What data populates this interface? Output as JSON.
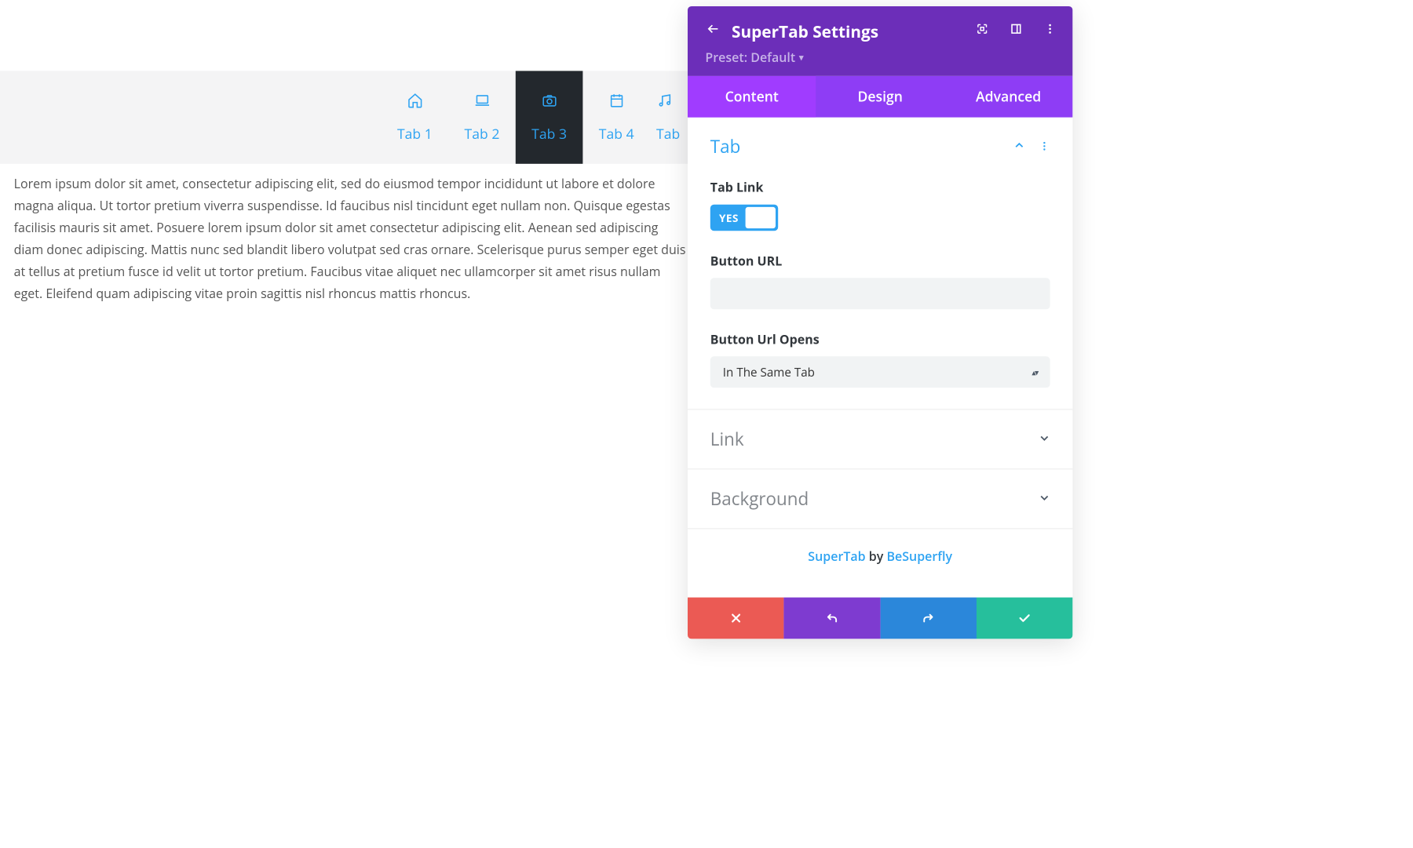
{
  "tabs": [
    {
      "label": "Tab 1",
      "icon": "home"
    },
    {
      "label": "Tab 2",
      "icon": "laptop"
    },
    {
      "label": "Tab 3",
      "icon": "camera",
      "active": true
    },
    {
      "label": "Tab 4",
      "icon": "calendar"
    },
    {
      "label": "Tab",
      "icon": "music"
    }
  ],
  "content_text": "Lorem ipsum dolor sit amet, consectetur adipiscing elit, sed do eiusmod tempor incididunt ut labore et dolore magna aliqua. Ut tortor pretium viverra suspendisse. Id faucibus nisl tincidunt eget nullam non. Quisque egestas facilisis mauris sit amet. Posuere lorem ipsum dolor sit amet consectetur adipiscing elit. Aenean sed adipiscing diam donec adipiscing. Mattis nunc sed blandit libero volutpat sed cras ornare. Scelerisque purus semper eget duis at tellus at pretium fusce id velit ut tortor pretium. Faucibus vitae aliquet nec ullamcorper sit amet risus nullam eget. Eleifend quam adipiscing vitae proin sagittis nisl rhoncus mattis rhoncus.",
  "panel": {
    "title": "SuperTab Settings",
    "preset": "Preset: Default",
    "tabs": {
      "content": "Content",
      "design": "Design",
      "advanced": "Advanced"
    },
    "section_tab": {
      "title": "Tab",
      "tablink_label": "Tab Link",
      "toggle_yes": "YES",
      "button_url_label": "Button URL",
      "button_url_value": "",
      "url_opens_label": "Button Url Opens",
      "url_opens_value": "In The Same Tab"
    },
    "section_link": "Link",
    "section_background": "Background",
    "footer": {
      "product": "SuperTab",
      "by": " by ",
      "author": "BeSuperfly"
    }
  }
}
